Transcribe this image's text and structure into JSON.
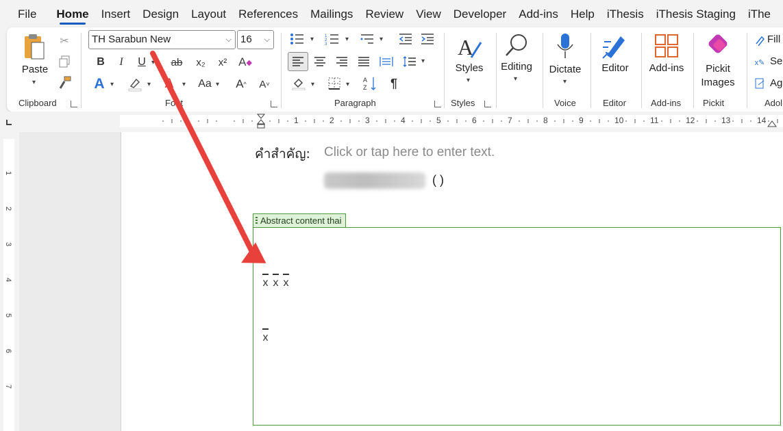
{
  "menu": {
    "tabs": [
      "File",
      "Home",
      "Insert",
      "Design",
      "Layout",
      "References",
      "Mailings",
      "Review",
      "View",
      "Developer",
      "Add-ins",
      "Help",
      "iThesis",
      "iThesis Staging",
      "iThe"
    ],
    "active": "Home"
  },
  "ribbon": {
    "clipboard": {
      "paste_label": "Paste",
      "group_label": "Clipboard"
    },
    "font": {
      "font_name": "TH Sarabun New",
      "font_size": "16",
      "group_label": "Font",
      "bold": "B",
      "italic": "I",
      "underline": "U",
      "strike": "ab",
      "subscript": "x₂",
      "superscript": "x²",
      "change_case": "Aa",
      "grow": "A^",
      "shrink": "A˅"
    },
    "paragraph": {
      "group_label": "Paragraph",
      "pilcrow": "¶"
    },
    "styles": {
      "label": "Styles",
      "group_label": "Styles"
    },
    "editing": {
      "label": "Editing"
    },
    "voice": {
      "dictate_label": "Dictate",
      "group_label": "Voice"
    },
    "editor": {
      "label": "Editor",
      "group_label": "Editor"
    },
    "addins": {
      "label": "Add-ins",
      "group_label": "Add-ins"
    },
    "pickit": {
      "label_line1": "Pickit",
      "label_line2": "Images",
      "group_label": "Pickit"
    },
    "adobe": {
      "fill": "Fill",
      "sen": "Ser",
      "ag": "Ag",
      "group_label": "Adol"
    }
  },
  "ruler": {
    "h_ticks": [
      "1",
      "2",
      "3",
      "4",
      "5",
      "6",
      "7",
      "8",
      "9",
      "10",
      "11",
      "12",
      "13",
      "14"
    ],
    "v_ticks": [
      "1",
      "2",
      "3",
      "4",
      "5",
      "6",
      "7"
    ]
  },
  "document": {
    "keyword_label": "คำสำคัญ:",
    "placeholder": "Click or tap here to enter text.",
    "paren": "( )",
    "content_control_tag": "Abstract content thai",
    "xbar_row1": [
      "x",
      "x",
      "x"
    ],
    "xbar_row2": [
      "x"
    ],
    "annotation_arrow_color": "#e8413c",
    "accent_color": "#185abd",
    "cc_border_color": "#4a9a3a"
  }
}
